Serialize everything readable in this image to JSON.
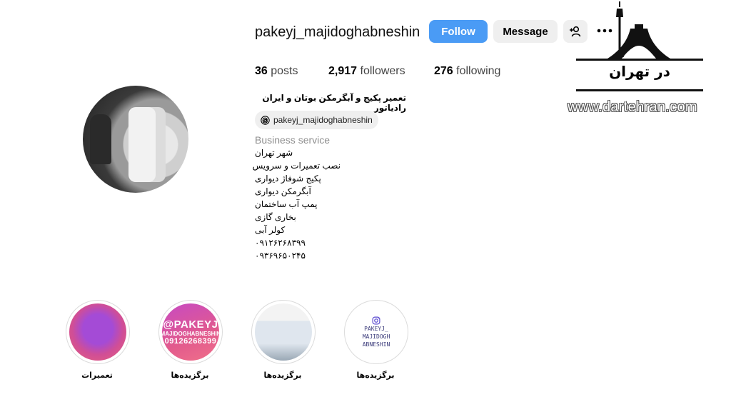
{
  "profile": {
    "username": "pakeyj_majidoghabneshin",
    "follow_label": "Follow",
    "message_label": "Message",
    "stats": {
      "posts_count": "36",
      "posts_label": "posts",
      "followers_count": "2,917",
      "followers_label": "followers",
      "following_count": "276",
      "following_label": "following"
    },
    "full_name": "تعمیر پکیج و آبگرمکن بوتان و ایران رادیاتور",
    "threads_handle": "pakeyj_majidoghabneshin",
    "category": "Business service",
    "bio_lines": [
      "شهر تهران",
      "نصب تعمیرات و سرویس",
      "پکیج شوفاژ دیواری",
      "آبگرمکن دیواری",
      "پمپ آب ساختمان",
      "بخاری گازی",
      "کولر آبی",
      "۰۹۱۲۶۲۶۸۳۹۹",
      "۰۹۳۶۹۶۵۰۲۴۵"
    ]
  },
  "highlights": [
    {
      "label": "تعمیرات"
    },
    {
      "label": "برگزیده‌ها",
      "cover_big": "@PAKEYJ",
      "cover_small": "MAJIDOGHABNESHIN",
      "cover_phone": "09126268399"
    },
    {
      "label": "برگزیده‌ها"
    },
    {
      "label": "برگزیده‌ها",
      "cover_lines": [
        "PAKEYJ_",
        "MAJIDOGH",
        "ABNESHIN"
      ]
    }
  ],
  "watermark": {
    "logo_text": "در تهران",
    "site": "www.dartehran.com"
  },
  "colors": {
    "follow_blue": "#4a9bf5",
    "secondary_btn": "#efefef",
    "muted_text": "#8e8e8e"
  },
  "icons": {
    "add_user": "add-user-icon",
    "more": "more-dots-icon",
    "threads": "threads-icon",
    "instagram": "instagram-icon"
  }
}
